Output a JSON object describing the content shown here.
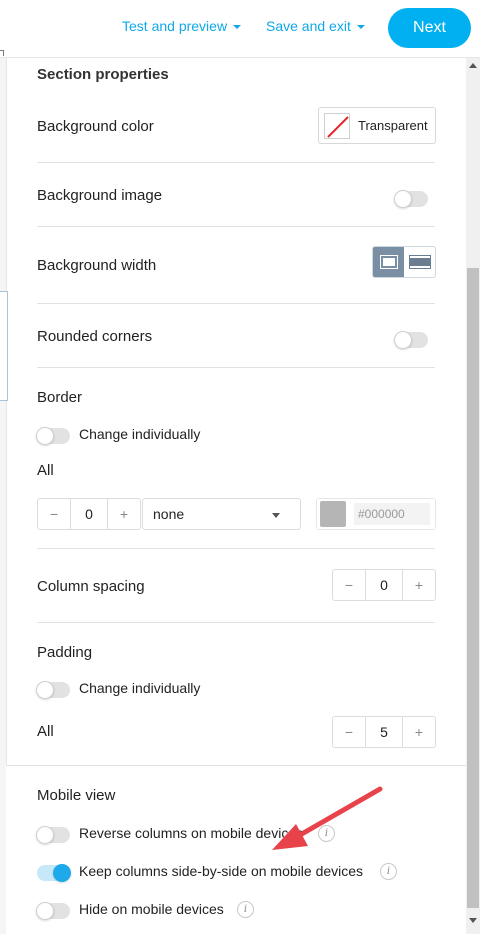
{
  "topbar": {
    "test_preview": "Test and preview",
    "save_exit": "Save and exit",
    "next": "Next"
  },
  "panel": {
    "section_title": "Section properties",
    "background_color": {
      "label": "Background color",
      "value": "Transparent"
    },
    "background_image": {
      "label": "Background image",
      "enabled": false
    },
    "background_width": {
      "label": "Background width",
      "selected": "contained"
    },
    "rounded_corners": {
      "label": "Rounded corners",
      "enabled": false
    },
    "border": {
      "title": "Border",
      "change_individually": "Change individually",
      "all_label": "All",
      "width": "0",
      "minus": "−",
      "plus": "+",
      "style": "none",
      "color_hex": "#000000"
    },
    "column_spacing": {
      "label": "Column spacing",
      "value": "0",
      "minus": "−",
      "plus": "+"
    },
    "padding": {
      "title": "Padding",
      "change_individually": "Change individually",
      "all_label": "All",
      "value": "5",
      "minus": "−",
      "plus": "+"
    },
    "mobile": {
      "title": "Mobile view",
      "reverse_columns": "Reverse columns on mobile devices",
      "keep_side_by_side": "Keep columns side-by-side on mobile devices",
      "hide": "Hide on mobile devices",
      "info": "i"
    }
  },
  "colors": {
    "accent": "#00b0f0",
    "link": "#10a8e8",
    "annotation_arrow": "#e8424a"
  }
}
